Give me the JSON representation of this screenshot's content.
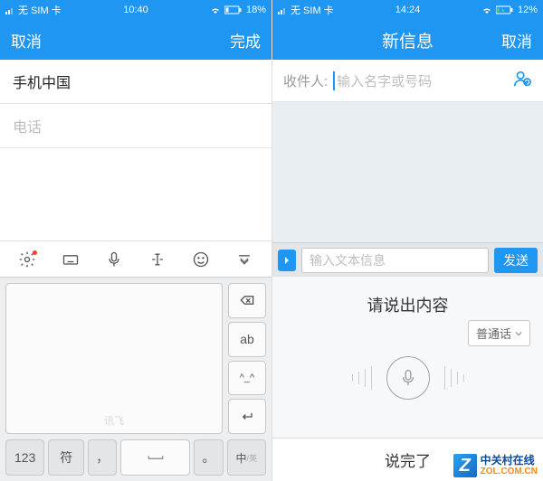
{
  "left": {
    "status": {
      "sim": "无 SIM 卡",
      "time": "10:40",
      "battery": "18%"
    },
    "header": {
      "cancel": "取消",
      "done": "完成"
    },
    "fields": {
      "name_value": "手机中国",
      "phone_placeholder": "电话"
    },
    "kb": {
      "side": {
        "backspace": "⌫",
        "ab": "ab",
        "face": "^_^",
        "enter": "↵"
      },
      "bottom": {
        "num": "123",
        "sym": "符",
        "comma": "，",
        "period": "。",
        "lang": "中/英"
      },
      "hint": "讯飞"
    }
  },
  "right": {
    "status": {
      "sim": "无 SIM 卡",
      "time": "14:24",
      "battery": "12%"
    },
    "header": {
      "title": "新信息",
      "cancel": "取消"
    },
    "recipient": {
      "label": "收件人:",
      "placeholder": "输入名字或号码"
    },
    "input": {
      "placeholder": "输入文本信息",
      "send": "发送"
    },
    "voice": {
      "title": "请说出内容",
      "lang": "普通话",
      "done": "说完了"
    }
  },
  "watermark": {
    "cn": "中关村在线",
    "url": "ZOL.COM.CN"
  }
}
